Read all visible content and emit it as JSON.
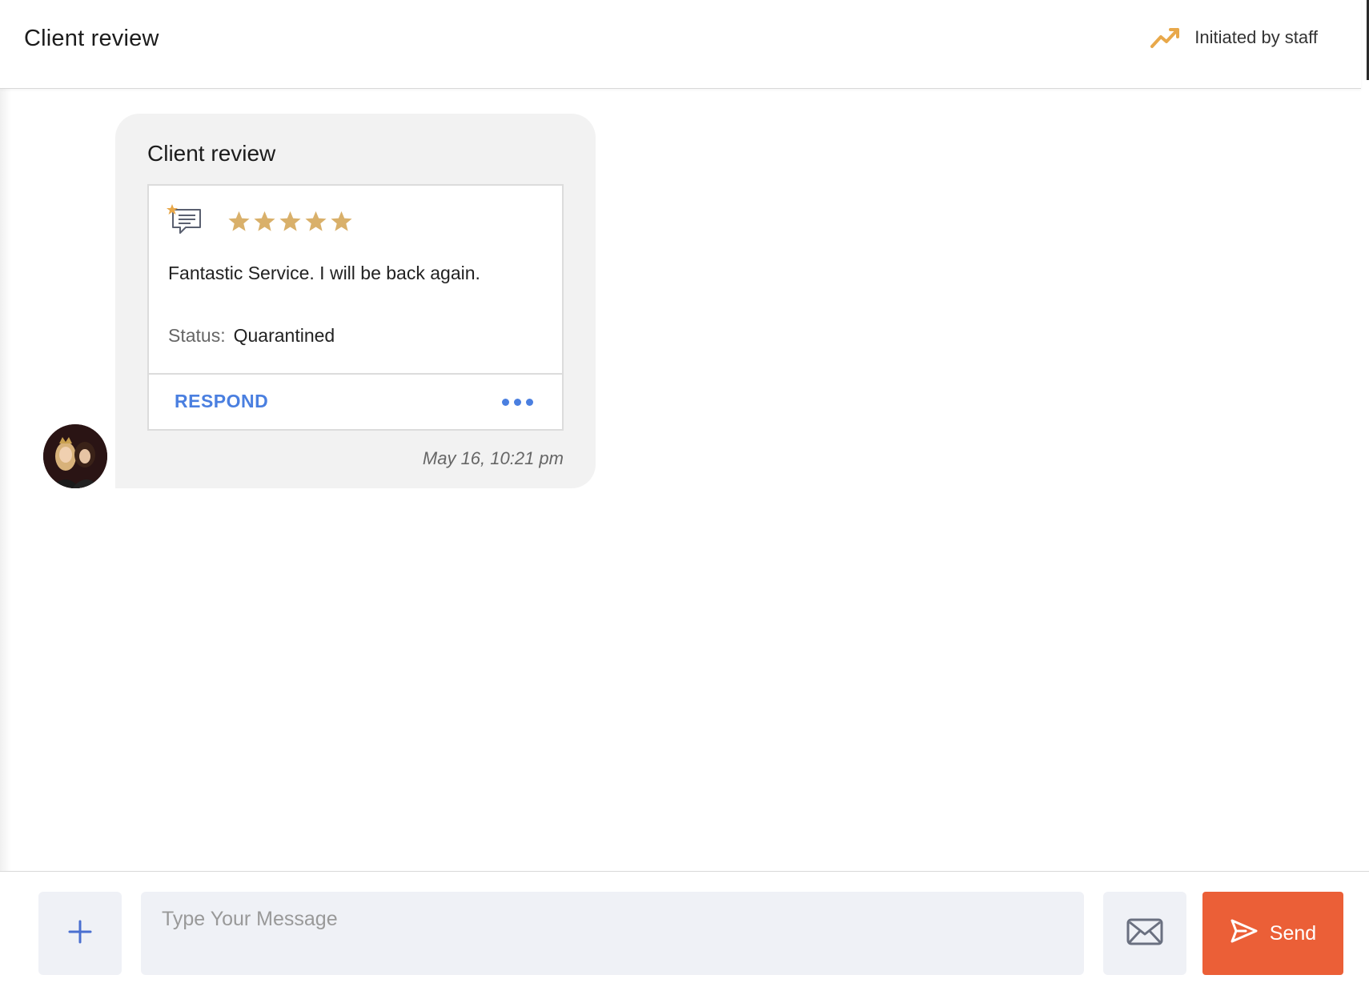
{
  "header": {
    "title": "Client review",
    "initiated_label": "Initiated by staff",
    "initiated_icon": "trending-up-icon",
    "accent_color": "#e8a84a"
  },
  "message": {
    "title": "Client review",
    "card": {
      "icon": "review-chat-icon",
      "rating": 5,
      "rating_max": 5,
      "star_color": "#d9b06a",
      "text": "Fantastic Service. I will be back again.",
      "status_label": "Status:",
      "status_value": "Quarantined",
      "respond_label": "RESPOND",
      "more_icon": "more-dots-icon",
      "link_color": "#4a7fe0"
    },
    "timestamp": "May 16, 10:21 pm"
  },
  "composer": {
    "add_icon": "plus-icon",
    "placeholder": "Type Your Message",
    "value": "",
    "email_icon": "envelope-icon",
    "send_label": "Send",
    "send_icon": "paper-plane-icon",
    "send_color": "#eb5f37"
  }
}
